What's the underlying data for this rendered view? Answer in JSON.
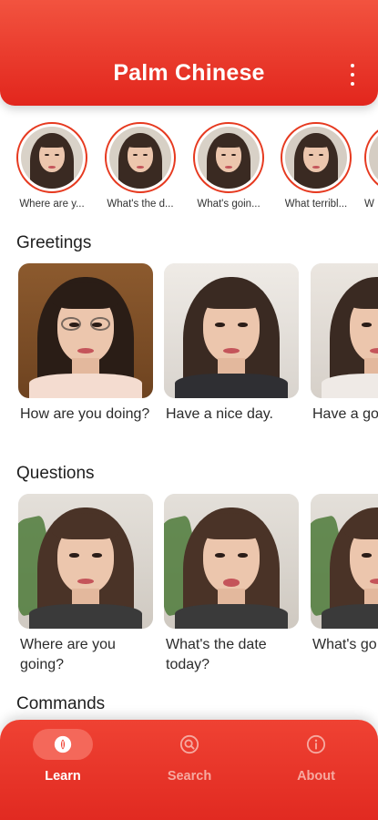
{
  "app": {
    "title": "Palm Chinese"
  },
  "stories": [
    {
      "label": "Where are y..."
    },
    {
      "label": "What's the d..."
    },
    {
      "label": "What's goin..."
    },
    {
      "label": "What terribl..."
    },
    {
      "label": "W"
    }
  ],
  "sections": {
    "greetings": {
      "title": "Greetings",
      "cards": [
        {
          "label": "How are you doing?"
        },
        {
          "label": "Have a nice day."
        },
        {
          "label": "Have a go"
        }
      ]
    },
    "questions": {
      "title": "Questions",
      "cards": [
        {
          "label": "Where are you going?"
        },
        {
          "label": "What's the date today?"
        },
        {
          "label": "What's go"
        }
      ]
    },
    "commands": {
      "title": "Commands"
    }
  },
  "nav": {
    "items": [
      {
        "label": "Learn",
        "icon": "learn-icon",
        "active": true
      },
      {
        "label": "Search",
        "icon": "search-icon",
        "active": false
      },
      {
        "label": "About",
        "icon": "info-icon",
        "active": false
      }
    ]
  },
  "colors": {
    "brand": "#e2261d",
    "ring": "#e6391f"
  }
}
